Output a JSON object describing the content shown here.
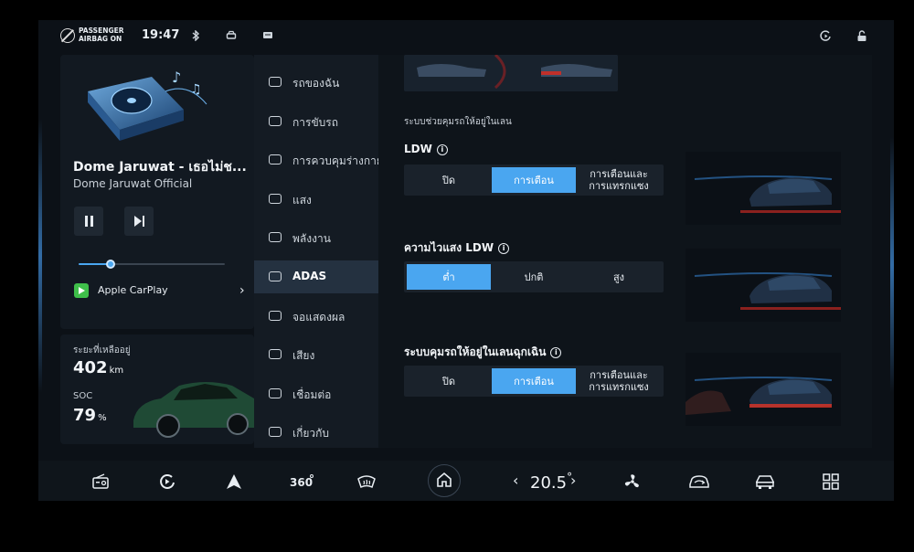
{
  "status_bar": {
    "airbag_line1": "PASSENGER",
    "airbag_line2": "AIRBAG ON",
    "time": "19:47",
    "icons": [
      "airbag-icon",
      "bluetooth-icon",
      "car-icon",
      "message-icon",
      "carplay-icon",
      "lock-icon"
    ]
  },
  "media": {
    "title": "Dome Jaruwat - เธอไม่ช...",
    "artist": "Dome Jaruwat Official",
    "progress": 0.22,
    "source_label": "Apple CarPlay"
  },
  "vehicle": {
    "range_label": "ระยะที่เหลืออยู่",
    "range_value": "402",
    "range_unit": "km",
    "soc_label": "SOC",
    "soc_value": "79",
    "soc_unit": "%"
  },
  "nav": {
    "items": [
      {
        "label": "รถของฉัน",
        "icon": "car-icon"
      },
      {
        "label": "การขับรถ",
        "icon": "steering-icon"
      },
      {
        "label": "การควบคุมร่างกาย",
        "icon": "body-control-icon"
      },
      {
        "label": "แสง",
        "icon": "light-icon"
      },
      {
        "label": "พลังงาน",
        "icon": "battery-icon"
      },
      {
        "label": "ADAS",
        "icon": "adas-icon"
      },
      {
        "label": "จอแสดงผล",
        "icon": "display-icon"
      },
      {
        "label": "เสียง",
        "icon": "speaker-icon"
      },
      {
        "label": "เชื่อมต่อ",
        "icon": "connect-icon"
      },
      {
        "label": "เกี่ยวกับ",
        "icon": "info-icon"
      }
    ],
    "active_index": 5
  },
  "content": {
    "section_title": "ระบบช่วยคุมรถให้อยู่ในเลน",
    "rows": [
      {
        "title": "LDW",
        "options": [
          "ปิด",
          "การเตือน",
          "การเตือนและ\nการแทรกแซง"
        ],
        "selected": 1
      },
      {
        "title": "ความไวแสง LDW",
        "options": [
          "ต่ำ",
          "ปกติ",
          "สูง"
        ],
        "selected": 0
      },
      {
        "title": "ระบบคุมรถให้อยู่ในเลนฉุกเฉิน",
        "options": [
          "ปิด",
          "การเตือน",
          "การเตือนและ\nการแทรกแซง"
        ],
        "selected": 1
      }
    ]
  },
  "dock": {
    "temperature": "20.5",
    "temperature_unit": "°",
    "icons": [
      "radio-icon",
      "carplay-icon",
      "navigation-icon",
      "camera-360-icon",
      "defrost-icon",
      "home-icon",
      "fan-icon",
      "ac-recirculation-icon",
      "car-icon",
      "apps-grid-icon"
    ]
  },
  "colors": {
    "accent": "#4aa6f0",
    "background": "#0c1117",
    "panel": "#121921"
  }
}
